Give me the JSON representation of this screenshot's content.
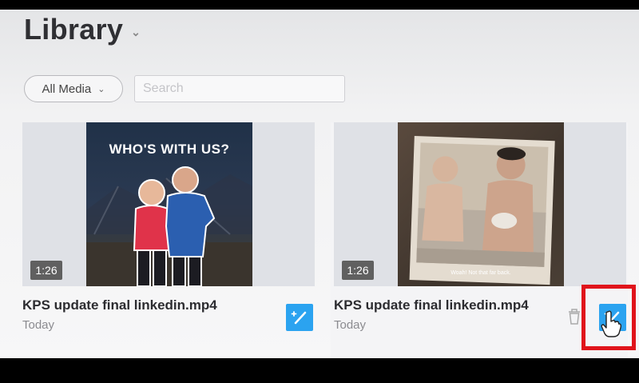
{
  "header": {
    "title": "Library"
  },
  "filters": {
    "media_filter": "All Media",
    "search_placeholder": "Search"
  },
  "media_items": [
    {
      "name": "KPS update final linkedin.mp4",
      "date": "Today",
      "duration": "1:26",
      "thumbnail_text": "WHO'S WITH US?"
    },
    {
      "name": "KPS update final linkedin.mp4",
      "date": "Today",
      "duration": "1:26",
      "thumbnail_caption": "Woah! Not that far back."
    }
  ],
  "colors": {
    "edit_button": "#2ba3f0",
    "highlight_box": "#e0141b"
  }
}
